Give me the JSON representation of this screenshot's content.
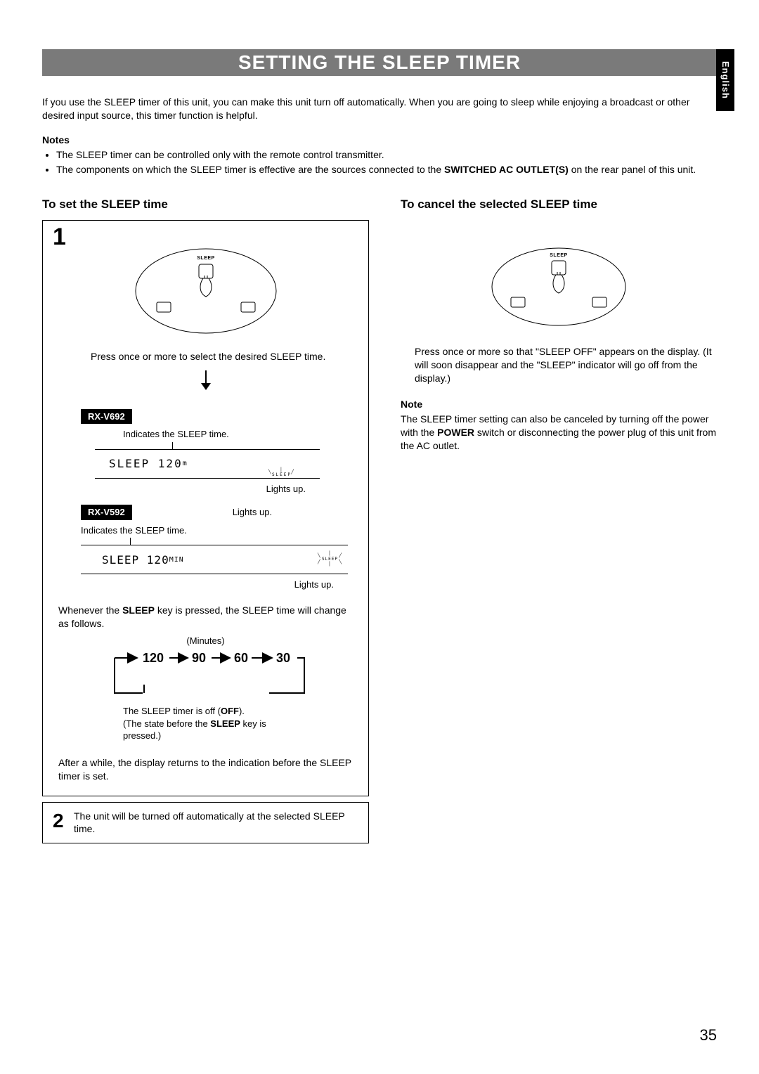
{
  "lang_tab": "English",
  "title": "SETTING THE SLEEP TIMER",
  "intro": "If you use the SLEEP timer of this unit, you can make this unit turn off automatically. When you are going to sleep while enjoying a broadcast or other desired input source, this timer function is helpful.",
  "notes_heading": "Notes",
  "notes": [
    "The SLEEP timer can be controlled only with the remote control transmitter.",
    "The components on which the SLEEP timer is effective are the sources connected to the SWITCHED AC OUTLET(S) on the rear panel of this unit."
  ],
  "subhead_set": "To set the SLEEP time",
  "subhead_cancel": "To cancel the selected SLEEP time",
  "step1_num": "1",
  "sleep_btn_label": "SLEEP",
  "press_set": "Press once or more to select the desired SLEEP time.",
  "model_692": "RX-V692",
  "indicates_692": "Indicates the SLEEP time.",
  "display_692": "SLEEP  120",
  "display_692_unit": "m",
  "sleep_indic": "SLEEP",
  "lights_up": "Lights up.",
  "model_592": "RX-V592",
  "indicates_592": "Indicates the SLEEP time.",
  "display_592": "SLEEP 120",
  "display_592_unit": "MIN",
  "sleep_para_pre": "Whenever the ",
  "sleep_para_bold": "SLEEP",
  "sleep_para_post": " key is pressed, the SLEEP time will change as follows.",
  "cycle_label": "(Minutes)",
  "cycle_values": [
    "120",
    "90",
    "60",
    "30"
  ],
  "off_note_pre": "The SLEEP timer is off (",
  "off_note_bold1": "OFF",
  "off_note_mid": ").\n(The state before the ",
  "off_note_bold2": "SLEEP",
  "off_note_post": " key is pressed.)",
  "after_note": "After a while, the display returns to the indication before the SLEEP timer is set.",
  "step2_num": "2",
  "step2_text": "The unit will be turned off automatically at the selected SLEEP time.",
  "cancel_press": "Press once or more so that \"SLEEP OFF\" appears on the display. (It will soon disappear and the \"SLEEP\" indicator will go off from the display.)",
  "note_heading": "Note",
  "cancel_note_pre": "The SLEEP timer setting can also be canceled by turning off the power with the ",
  "cancel_note_bold": "POWER",
  "cancel_note_post": " switch or disconnecting the power plug of this unit from the AC outlet.",
  "page_number": "35"
}
